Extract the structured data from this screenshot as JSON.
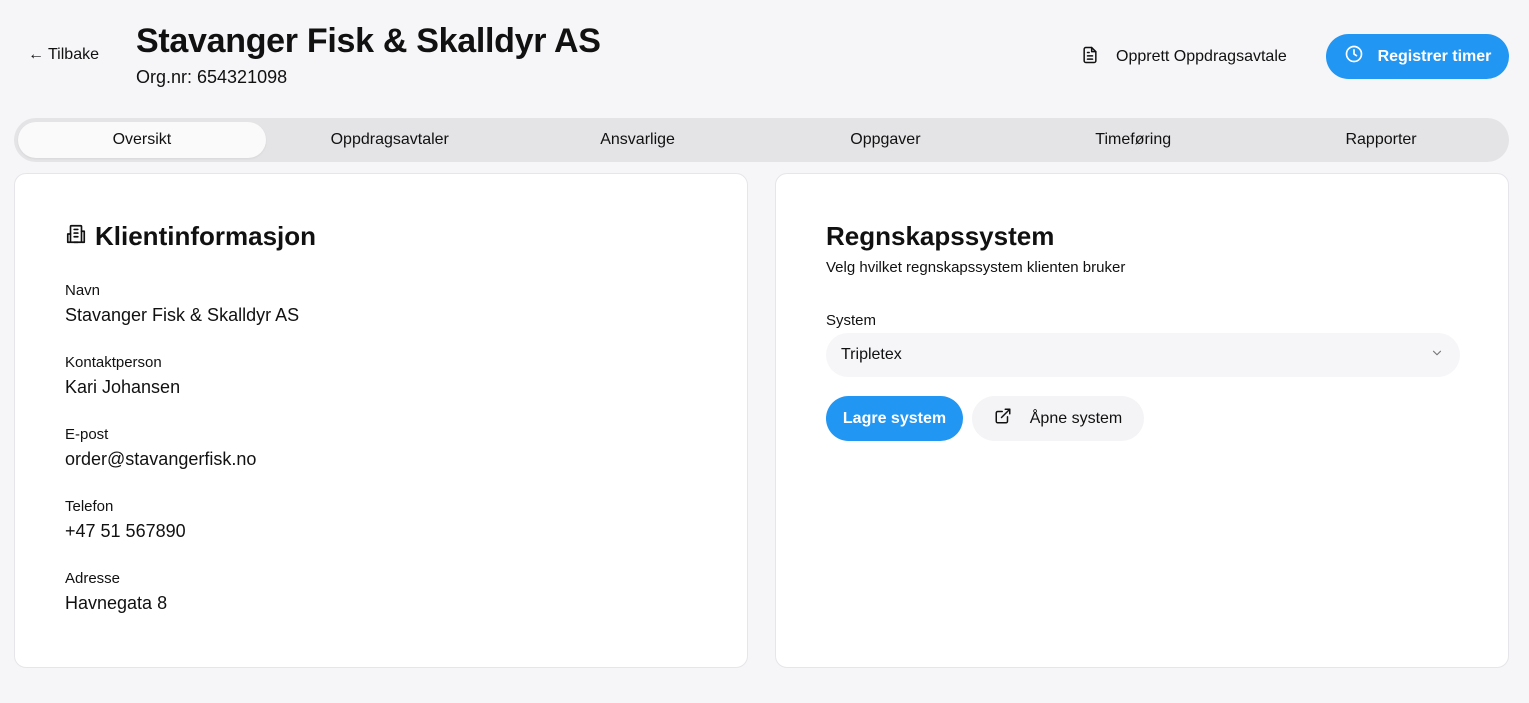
{
  "header": {
    "back_label": "Tilbake",
    "title": "Stavanger Fisk & Skalldyr AS",
    "org_number": "Org.nr: 654321098",
    "create_agreement_label": "Opprett Oppdragsavtale",
    "register_time_label": "Registrer timer"
  },
  "tabs": [
    {
      "label": "Oversikt",
      "active": true
    },
    {
      "label": "Oppdragsavtaler",
      "active": false
    },
    {
      "label": "Ansvarlige",
      "active": false
    },
    {
      "label": "Oppgaver",
      "active": false
    },
    {
      "label": "Timeføring",
      "active": false
    },
    {
      "label": "Rapporter",
      "active": false
    }
  ],
  "client_info": {
    "heading": "Klientinformasjon",
    "fields": [
      {
        "label": "Navn",
        "value": "Stavanger Fisk & Skalldyr AS"
      },
      {
        "label": "Kontaktperson",
        "value": "Kari Johansen"
      },
      {
        "label": "E-post",
        "value": "order@stavangerfisk.no"
      },
      {
        "label": "Telefon",
        "value": "+47 51 567890"
      },
      {
        "label": "Adresse",
        "value": "Havnegata 8"
      }
    ]
  },
  "accounting": {
    "heading": "Regnskapssystem",
    "subtitle": "Velg hvilket regnskapssystem klienten bruker",
    "system_label": "System",
    "selected_system": "Tripletex",
    "save_label": "Lagre system",
    "open_label": "Åpne system"
  },
  "colors": {
    "accent": "#2196f3",
    "background": "#f6f6f9",
    "tabs_background": "#e4e4e7"
  },
  "icons": {
    "back": "arrow-left-icon",
    "document": "document-icon",
    "clock": "clock-icon",
    "building": "building-icon",
    "chevron": "chevron-down-icon",
    "external": "external-link-icon"
  }
}
